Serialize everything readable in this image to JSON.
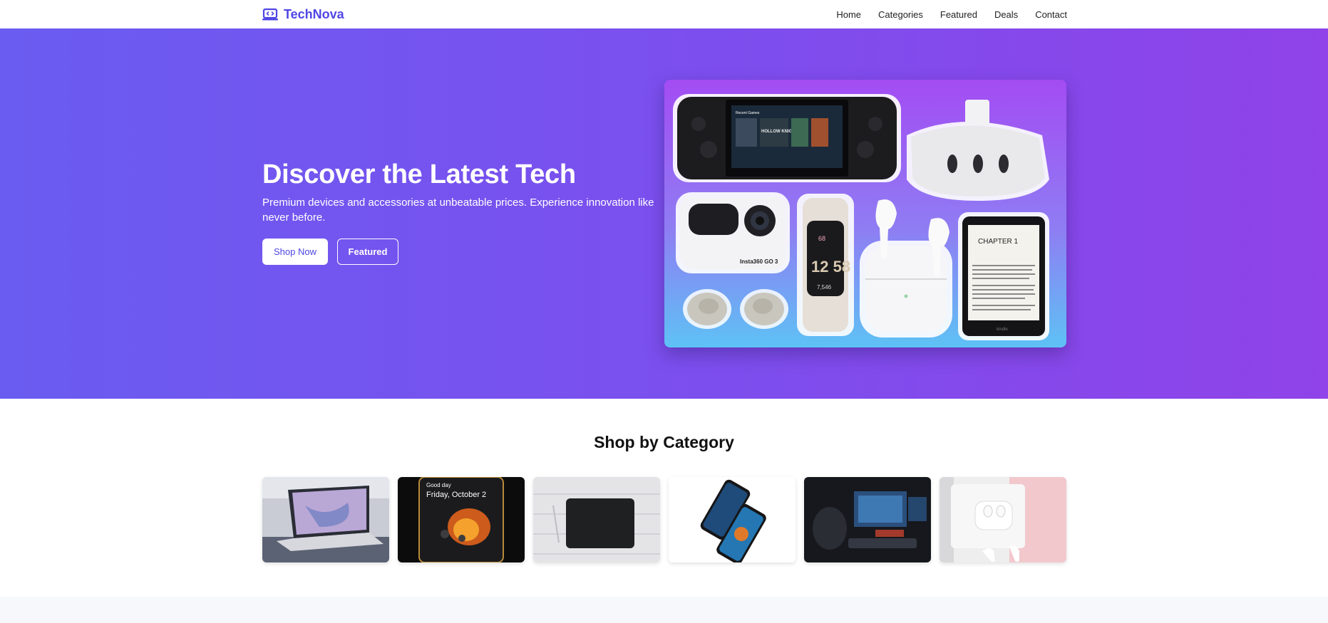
{
  "brand": {
    "name": "TechNova",
    "color": "#4f46e5"
  },
  "nav": {
    "items": [
      "Home",
      "Categories",
      "Featured",
      "Deals",
      "Contact"
    ]
  },
  "hero": {
    "title": "Discover the Latest Tech",
    "subtitle": "Premium devices and accessories at unbeatable prices. Experience innovation like never before.",
    "primary_button": "Shop Now",
    "secondary_button": "Featured",
    "product_image": {
      "products": [
        "handheld game console",
        "VR headset",
        "action camera",
        "fitness band",
        "wireless earbuds",
        "earbuds case",
        "e-reader"
      ],
      "camera_label": "Insta360 GO 3",
      "tracker_time": "12 58",
      "tracker_steps": "7,546",
      "tracker_heart": "68",
      "ereader_heading": "CHAPTER 1",
      "ereader_brand": "kindle",
      "console_game": "HOLLOW KNIGHT",
      "console_section": "Recent Games"
    }
  },
  "categories": {
    "title": "Shop by Category",
    "cards": [
      {
        "depicts": "laptop"
      },
      {
        "depicts": "smartwatch",
        "screen_text": "Friday, October 2",
        "screen_small": "Good day"
      },
      {
        "depicts": "tablet"
      },
      {
        "depicts": "smartphones"
      },
      {
        "depicts": "gaming setup"
      },
      {
        "depicts": "wireless earbuds"
      }
    ]
  },
  "colors": {
    "hero_gradient_start": "#6a5cf0",
    "hero_gradient_end": "#8f43e8",
    "accent": "#4f46e5"
  }
}
